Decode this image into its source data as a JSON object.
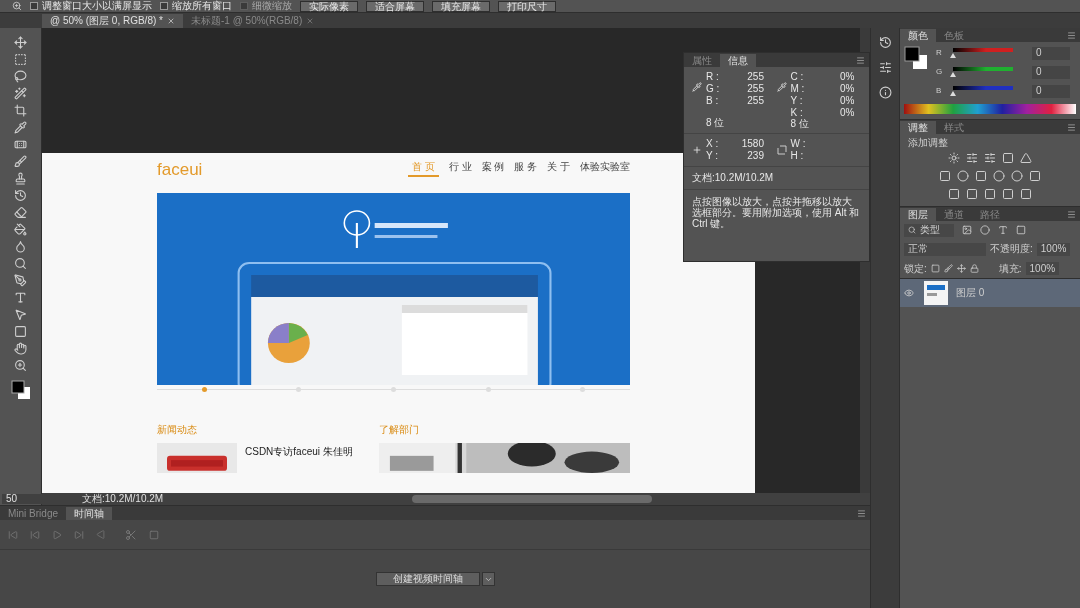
{
  "options_bar": {
    "checkboxes": [
      {
        "label": "调整窗口大小以满屏显示",
        "checked": false,
        "disabled": false
      },
      {
        "label": "缩放所有窗口",
        "checked": false,
        "disabled": false
      },
      {
        "label": "细微缩放",
        "checked": false,
        "disabled": true
      }
    ],
    "buttons": [
      "实际像素",
      "适合屏幕",
      "填充屏幕",
      "打印尺寸"
    ]
  },
  "doc_tabs": [
    {
      "label": "@ 50% (图层 0, RGB/8) *",
      "selected": true
    },
    {
      "label": "未标题-1 @ 50%(RGB/8)",
      "selected": false
    }
  ],
  "info_panel": {
    "tabs": [
      {
        "label": "属性",
        "selected": false
      },
      {
        "label": "信息",
        "selected": true
      }
    ],
    "rgb": [
      {
        "label": "R :",
        "value": "255"
      },
      {
        "label": "G :",
        "value": "255"
      },
      {
        "label": "B :",
        "value": "255"
      }
    ],
    "cmyk": [
      {
        "label": "C :",
        "value": "0%"
      },
      {
        "label": "M :",
        "value": "0%"
      },
      {
        "label": "Y :",
        "value": "0%"
      },
      {
        "label": "K :",
        "value": "0%"
      }
    ],
    "bits": [
      "8 位",
      "8 位"
    ],
    "position": [
      {
        "label": "X :",
        "value": "1580"
      },
      {
        "label": "Y :",
        "value": "239"
      }
    ],
    "size": [
      {
        "label": "W :"
      },
      {
        "label": "H :"
      }
    ],
    "document": "文档:10.2M/10.2M",
    "hint": "点按图像以放大，点按并拖移以放大选框部分。要用附加选项，使用 Alt 和 Ctrl 键。"
  },
  "website": {
    "logo": "faceui",
    "nav": [
      {
        "label": "首 页",
        "selected": true
      },
      {
        "label": "行 业",
        "selected": false
      },
      {
        "label": "案 例",
        "selected": false
      },
      {
        "label": "服 务",
        "selected": false
      },
      {
        "label": "关 于",
        "selected": false
      },
      {
        "label": "体验实验室",
        "selected": false
      }
    ],
    "carousel": [
      {
        "selected": true
      },
      {
        "selected": false
      },
      {
        "selected": false
      },
      {
        "selected": false
      },
      {
        "selected": false
      }
    ],
    "sections": [
      "新闻动态",
      "了解部门"
    ],
    "news_title": "CSDN专访faceui 朱佳明"
  },
  "status_bar": {
    "zoom": "50",
    "document": "文档:10.2M/10.2M"
  },
  "color_panel": {
    "tabs": [
      {
        "label": "颜色",
        "selected": true
      },
      {
        "label": "色板",
        "selected": false
      }
    ],
    "channels": [
      {
        "label": "R",
        "value": "0",
        "level": 0,
        "color": "#d02020"
      },
      {
        "label": "G",
        "value": "0",
        "level": 0,
        "color": "#20b030"
      },
      {
        "label": "B",
        "value": "0",
        "level": 0,
        "color": "#2030c0"
      }
    ]
  },
  "adjust_panel": {
    "tabs": [
      {
        "label": "调整",
        "selected": true
      },
      {
        "label": "样式",
        "selected": false
      }
    ],
    "title": "添加调整"
  },
  "layers_panel": {
    "tabs": [
      {
        "label": "图层",
        "selected": true
      },
      {
        "label": "通道",
        "selected": false
      },
      {
        "label": "路径",
        "selected": false
      }
    ],
    "filter": "类型",
    "blend": "正常",
    "opacity_label": "不透明度:",
    "opacity": "100%",
    "lock_label": "锁定:",
    "fill_label": "填充:",
    "fill": "100%",
    "layers": [
      {
        "name": "图层 0",
        "visible": true,
        "selected": true
      }
    ]
  },
  "timeline": {
    "tabs": [
      {
        "label": "Mini Bridge",
        "selected": false
      },
      {
        "label": "时间轴",
        "selected": true
      }
    ],
    "button": "创建视频时间轴"
  }
}
